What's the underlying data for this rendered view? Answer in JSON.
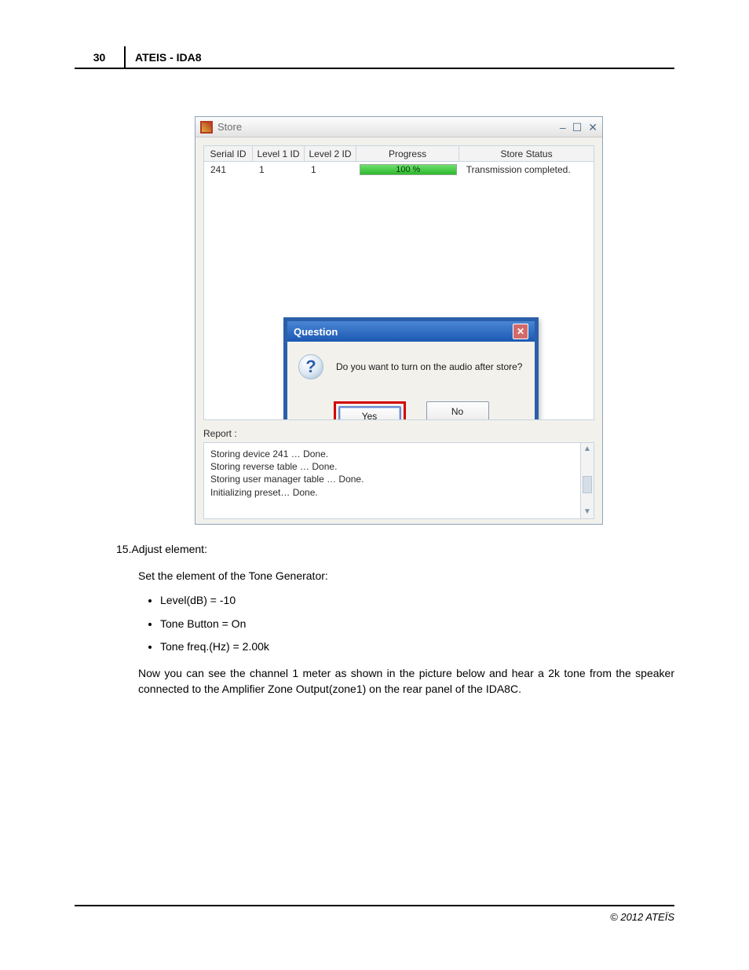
{
  "page_header": {
    "number": "30",
    "title": "ATEIS - IDA8"
  },
  "store_window": {
    "title": "Store",
    "wc_min": "–",
    "wc_max": "☐",
    "wc_close": "✕",
    "columns": [
      "Serial ID",
      "Level 1 ID",
      "Level 2 ID",
      "Progress",
      "Store Status"
    ],
    "row": {
      "serial": "241",
      "l1": "1",
      "l2": "1",
      "progress": "100 %",
      "status": "Transmission completed."
    },
    "report_label": "Report :",
    "report_lines": [
      "Storing device 241 …   Done.",
      "Storing reverse table …   Done.",
      "Storing user manager table …   Done.",
      "Initializing preset…   Done."
    ]
  },
  "question_dialog": {
    "title": "Question",
    "close": "✕",
    "icon_glyph": "?",
    "message": "Do you want to turn on the audio after store?",
    "yes": "Yes",
    "no": "No"
  },
  "doc": {
    "step_num": "15.Adjust element:",
    "set_line": "Set the element of the Tone Generator:",
    "bullet1": "Level(dB) = -10",
    "bullet2": "Tone Button = On",
    "bullet3": "Tone freq.(Hz) = 2.00k",
    "para": "Now you can see the channel 1 meter as shown in the picture below and hear a 2k tone from the speaker connected to the Amplifier Zone Output(zone1) on the rear panel of the IDA8C."
  },
  "footer": {
    "copyright": "© 2012 ATEÏS"
  }
}
